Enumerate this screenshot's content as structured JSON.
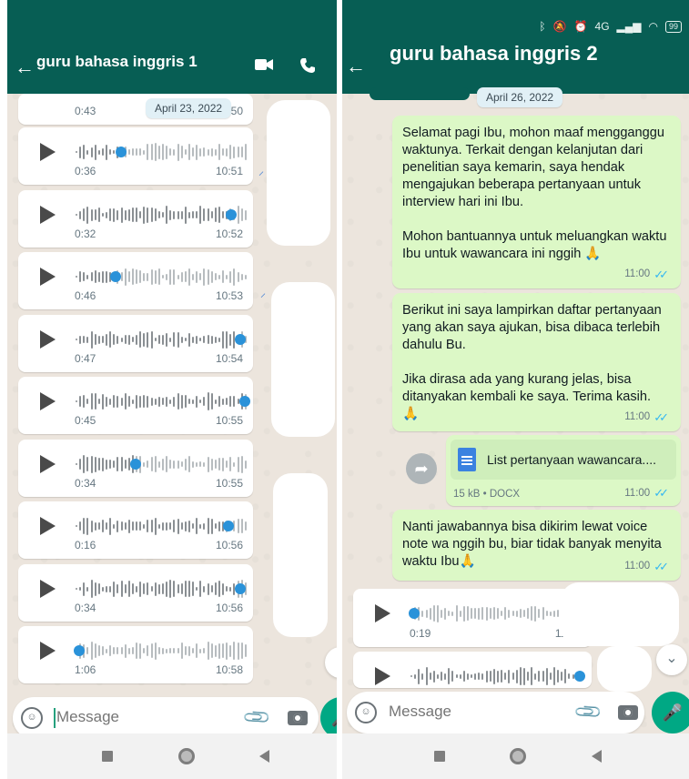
{
  "status_bar": {
    "battery": "99",
    "network": "4G"
  },
  "left_chat": {
    "title": "guru bahasa inggris 1",
    "date_chip": "April 23, 2022",
    "partial_top": {
      "duration": "0:43",
      "time": "10:50"
    },
    "voice_notes": [
      {
        "duration": "0:36",
        "time": "10:51",
        "progress": 0.25
      },
      {
        "duration": "0:32",
        "time": "10:52",
        "progress": 0.92
      },
      {
        "duration": "0:46",
        "time": "10:53",
        "progress": 0.22
      },
      {
        "duration": "0:47",
        "time": "10:54",
        "progress": 0.97
      },
      {
        "duration": "0:45",
        "time": "10:55",
        "progress": 1.0
      },
      {
        "duration": "0:34",
        "time": "10:55",
        "progress": 0.34
      },
      {
        "duration": "0:16",
        "time": "10:56",
        "progress": 0.9
      },
      {
        "duration": "0:34",
        "time": "10:56",
        "progress": 0.97
      },
      {
        "duration": "1:06",
        "time": "10:58",
        "progress": 0.0
      }
    ],
    "input_placeholder": "Message"
  },
  "right_chat": {
    "title": "guru bahasa inggris 2",
    "date_chip": "April 26, 2022",
    "messages": [
      {
        "type": "text",
        "paragraphs": [
          "Selamat pagi Ibu, mohon maaf mengganggu waktunya. Terkait dengan kelanjutan dari penelitian saya kemarin, saya hendak mengajukan beberapa pertanyaan untuk interview hari ini Ibu.",
          "Mohon bantuannya untuk meluangkan waktu Ibu untuk wawancara ini nggih 🙏"
        ],
        "time": "11:00"
      },
      {
        "type": "text",
        "paragraphs": [
          "Berikut ini saya lampirkan daftar pertanyaan yang akan saya ajukan, bisa dibaca terlebih dahulu Bu.",
          "Jika dirasa ada yang kurang jelas, bisa ditanyakan kembali ke saya. Terima kasih. 🙏"
        ],
        "time": "11:00"
      },
      {
        "type": "document",
        "file_name": "List pertanyaan wawancara....",
        "meta": "15 kB • DOCX",
        "time": "11:00"
      },
      {
        "type": "text",
        "paragraphs": [
          "Nanti jawabannya bisa dikirim lewat voice note wa nggih bu, biar tidak banyak menyita waktu Ibu🙏"
        ],
        "time": "11:00"
      }
    ],
    "voice_notes": [
      {
        "duration": "0:19",
        "time": "11:05",
        "progress": 0.0
      },
      {
        "duration": "",
        "time": "",
        "progress": 1.0
      }
    ],
    "input_placeholder": "Message"
  },
  "colors": {
    "header": "#075e54",
    "chat_background": "#ece5dd",
    "outgoing_bubble": "#dcf8c6",
    "waveform_played": "#2a92d9",
    "waveform_unplayed": "#b7bcbf",
    "waveform_base": "#8a8f93",
    "read_ticks": "#34b7f1",
    "fab": "#00a884"
  }
}
